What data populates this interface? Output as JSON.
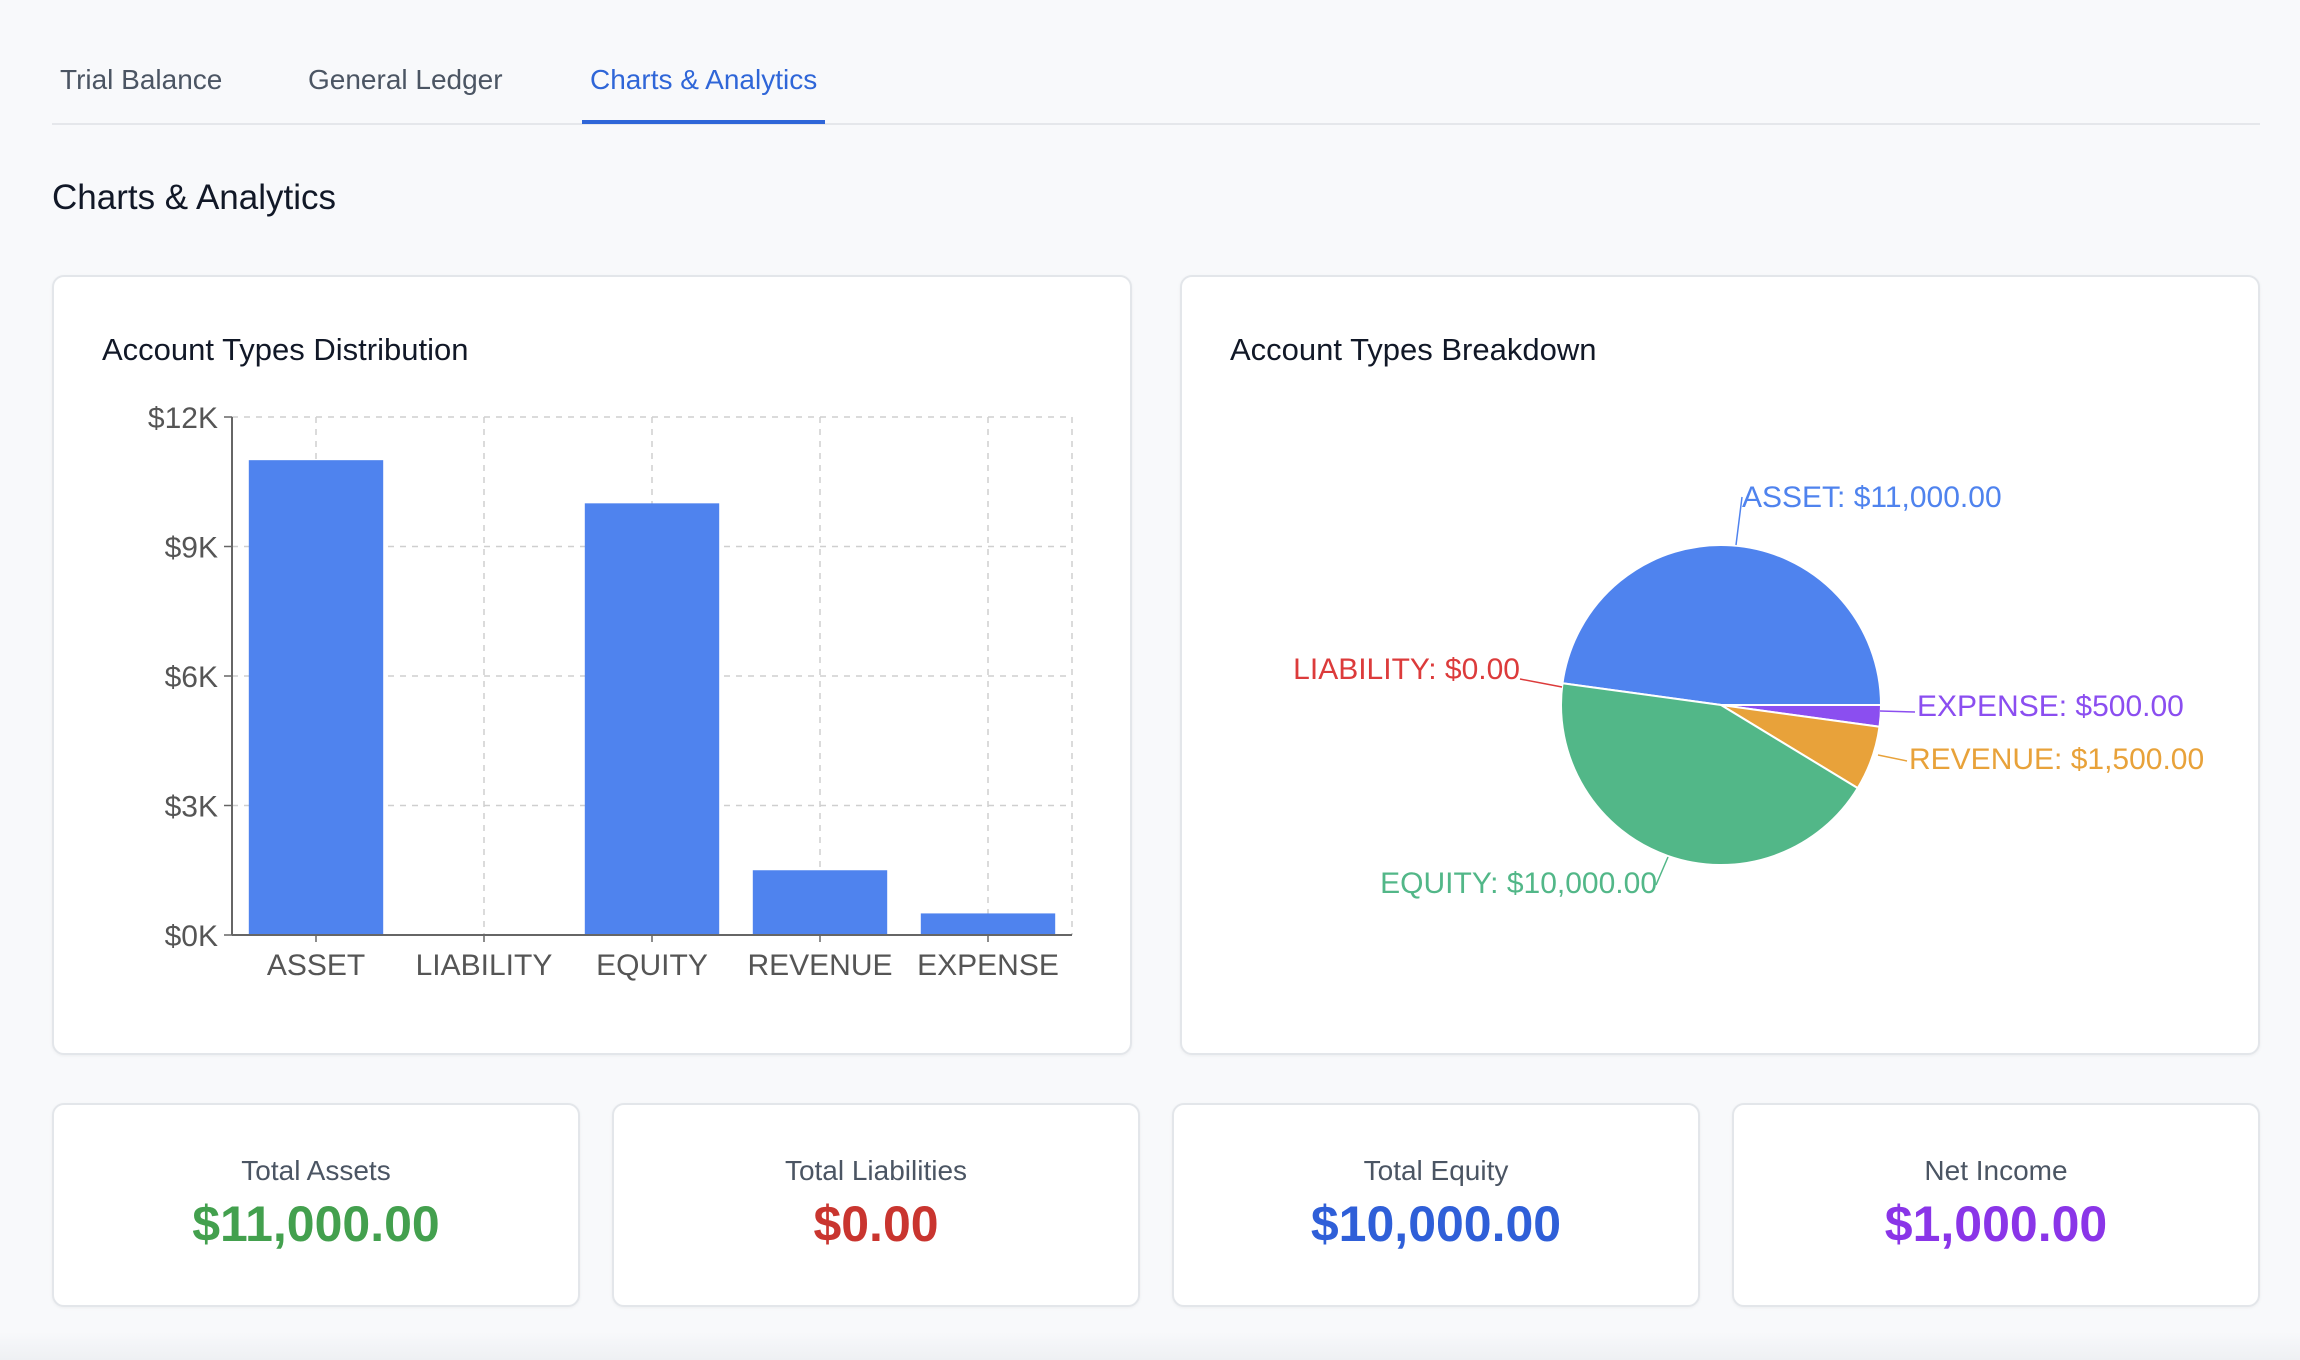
{
  "tabs": [
    {
      "label": "Trial Balance"
    },
    {
      "label": "General Ledger"
    },
    {
      "label": "Charts & Analytics"
    }
  ],
  "page": {
    "title": "Charts & Analytics"
  },
  "colors": {
    "accent": "#2f66d8",
    "asset": "#4f83ee",
    "liability": "#dc3b3b",
    "equity": "#52b788",
    "revenue": "#e8a23a",
    "expense": "#8b4ef0"
  },
  "bar_card": {
    "title": "Account Types Distribution"
  },
  "pie_card": {
    "title": "Account Types Breakdown"
  },
  "chart_data": [
    {
      "type": "bar",
      "title": "Account Types Distribution",
      "categories": [
        "ASSET",
        "LIABILITY",
        "EQUITY",
        "REVENUE",
        "EXPENSE"
      ],
      "values": [
        11000,
        0,
        10000,
        1500,
        500
      ],
      "yticks": [
        "$0K",
        "$3K",
        "$6K",
        "$9K",
        "$12K"
      ],
      "ylim": [
        0,
        12000
      ],
      "grid": true,
      "bar_color": "#4f83ee"
    },
    {
      "type": "pie",
      "title": "Account Types Breakdown",
      "slices": [
        {
          "label": "ASSET: $11,000.00",
          "value": 11000,
          "color": "#4f83ee"
        },
        {
          "label": "LIABILITY: $0.00",
          "value": 0,
          "color": "#dc3b3b"
        },
        {
          "label": "EQUITY: $10,000.00",
          "value": 10000,
          "color": "#52b788"
        },
        {
          "label": "REVENUE: $1,500.00",
          "value": 1500,
          "color": "#e8a23a"
        },
        {
          "label": "EXPENSE: $500.00",
          "value": 500,
          "color": "#8b4ef0"
        }
      ]
    }
  ],
  "stats": [
    {
      "label": "Total Assets",
      "value": "$11,000.00",
      "color": "#43a04e"
    },
    {
      "label": "Total Liabilities",
      "value": "$0.00",
      "color": "#c9352f"
    },
    {
      "label": "Total Equity",
      "value": "$10,000.00",
      "color": "#2f5fd8"
    },
    {
      "label": "Net Income",
      "value": "$1,000.00",
      "color": "#8a35e8"
    }
  ]
}
